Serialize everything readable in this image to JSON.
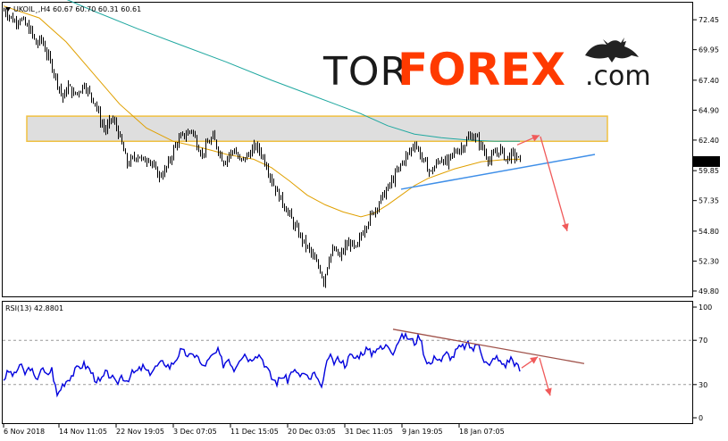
{
  "header": {
    "instrument_line": "UKOIL¸,H4  60.67 60.70 60.31 60.61",
    "rsi_line": "RSI(13) 42.8801"
  },
  "logo": {
    "part1": "TOR",
    "part2": "FOREX",
    "part3": ".com",
    "icon": "bull-bear-icon"
  },
  "colors": {
    "candle": "#000000",
    "ma_fast": "#e0a000",
    "ma_slow": "#20a8a0",
    "zone_fill": "#dedede",
    "zone_border": "#f0c040",
    "trend_blue": "#3f8fe8",
    "arrow_red": "#f05a5a",
    "rsi_line": "#0000dd",
    "rsi_trend": "#a0524a",
    "current_price_bg": "#000000"
  },
  "chart_data": [
    {
      "type": "candlestick",
      "symbol": "UKOIL",
      "timeframe": "H4",
      "ohlc_current": {
        "open": 60.67,
        "high": 60.7,
        "low": 60.31,
        "close": 60.61
      },
      "y_ticks": [
        72.45,
        69.95,
        67.4,
        64.9,
        62.4,
        59.85,
        57.35,
        54.8,
        52.3,
        49.8
      ],
      "ylim": [
        49.5,
        73.8
      ],
      "current_price": "60.61",
      "x_tick_labels": [
        "6 Nov 2018",
        "14 Nov 11:05",
        "22 Nov 19:05",
        "3 Dec 07:05",
        "11 Dec 15:05",
        "20 Dec 03:05",
        "31 Dec 11:05",
        "9 Jan 19:05",
        "18 Jan 07:05"
      ],
      "close_path": [
        [
          0,
          73.2
        ],
        [
          6,
          72.8
        ],
        [
          12,
          72.3
        ],
        [
          18,
          72.6
        ],
        [
          24,
          72.0
        ],
        [
          30,
          71.5
        ],
        [
          36,
          70.4
        ],
        [
          42,
          70.8
        ],
        [
          48,
          69.6
        ],
        [
          54,
          68.5
        ],
        [
          60,
          67.2
        ],
        [
          66,
          65.9
        ],
        [
          72,
          66.9
        ],
        [
          78,
          66.2
        ],
        [
          84,
          66.5
        ],
        [
          90,
          67.1
        ],
        [
          96,
          66.2
        ],
        [
          102,
          65.6
        ],
        [
          108,
          64.0
        ],
        [
          114,
          63.2
        ],
        [
          120,
          64.2
        ],
        [
          126,
          63.5
        ],
        [
          132,
          62.0
        ],
        [
          138,
          60.4
        ],
        [
          144,
          60.8
        ],
        [
          150,
          61.2
        ],
        [
          156,
          60.6
        ],
        [
          162,
          61.0
        ],
        [
          168,
          60.0
        ],
        [
          174,
          59.4
        ],
        [
          180,
          59.8
        ],
        [
          186,
          60.8
        ],
        [
          192,
          62.0
        ],
        [
          198,
          62.6
        ],
        [
          204,
          62.9
        ],
        [
          210,
          63.3
        ],
        [
          216,
          62.1
        ],
        [
          222,
          61.2
        ],
        [
          228,
          62.1
        ],
        [
          234,
          62.6
        ],
        [
          240,
          61.6
        ],
        [
          246,
          60.6
        ],
        [
          252,
          61.2
        ],
        [
          258,
          61.6
        ],
        [
          264,
          60.6
        ],
        [
          270,
          60.9
        ],
        [
          276,
          61.4
        ],
        [
          282,
          61.9
        ],
        [
          288,
          61.3
        ],
        [
          294,
          60.3
        ],
        [
          300,
          59.0
        ],
        [
          306,
          58.0
        ],
        [
          312,
          57.2
        ],
        [
          318,
          56.4
        ],
        [
          324,
          55.4
        ],
        [
          330,
          54.6
        ],
        [
          336,
          53.8
        ],
        [
          342,
          53.2
        ],
        [
          348,
          52.3
        ],
        [
          354,
          51.6
        ],
        [
          358,
          50.6
        ],
        [
          364,
          52.7
        ],
        [
          370,
          53.2
        ],
        [
          376,
          52.6
        ],
        [
          382,
          53.5
        ],
        [
          388,
          53.8
        ],
        [
          394,
          53.2
        ],
        [
          400,
          54.5
        ],
        [
          406,
          55.5
        ],
        [
          412,
          56.2
        ],
        [
          418,
          57.0
        ],
        [
          424,
          57.7
        ],
        [
          430,
          58.4
        ],
        [
          436,
          59.2
        ],
        [
          442,
          60.0
        ],
        [
          448,
          60.8
        ],
        [
          454,
          61.4
        ],
        [
          460,
          62.2
        ],
        [
          466,
          61.2
        ],
        [
          472,
          60.3
        ],
        [
          478,
          59.7
        ],
        [
          484,
          60.4
        ],
        [
          490,
          60.9
        ],
        [
          496,
          60.4
        ],
        [
          502,
          61.2
        ],
        [
          508,
          61.6
        ],
        [
          514,
          61.9
        ],
        [
          520,
          62.6
        ],
        [
          526,
          62.8
        ],
        [
          532,
          62.2
        ],
        [
          538,
          61.4
        ],
        [
          544,
          60.7
        ],
        [
          550,
          61.3
        ],
        [
          556,
          61.6
        ],
        [
          562,
          60.8
        ],
        [
          568,
          61.2
        ],
        [
          574,
          61.0
        ],
        [
          578,
          60.6
        ]
      ],
      "ma_fast": [
        [
          0,
          73.6
        ],
        [
          40,
          72.6
        ],
        [
          70,
          70.6
        ],
        [
          100,
          68.0
        ],
        [
          130,
          65.4
        ],
        [
          160,
          63.4
        ],
        [
          190,
          62.3
        ],
        [
          220,
          61.8
        ],
        [
          250,
          61.2
        ],
        [
          280,
          60.8
        ],
        [
          300,
          60.1
        ],
        [
          320,
          59.0
        ],
        [
          340,
          57.8
        ],
        [
          360,
          57.0
        ],
        [
          380,
          56.4
        ],
        [
          400,
          56.0
        ],
        [
          415,
          56.3
        ],
        [
          430,
          57.0
        ],
        [
          445,
          57.8
        ],
        [
          460,
          58.6
        ],
        [
          475,
          59.2
        ],
        [
          490,
          59.6
        ],
        [
          505,
          60.0
        ],
        [
          520,
          60.3
        ],
        [
          535,
          60.6
        ],
        [
          550,
          60.7
        ],
        [
          565,
          60.8
        ],
        [
          578,
          60.8
        ]
      ],
      "ma_slow": [
        [
          0,
          76.5
        ],
        [
          50,
          74.8
        ],
        [
          100,
          73.2
        ],
        [
          150,
          71.7
        ],
        [
          200,
          70.3
        ],
        [
          250,
          68.9
        ],
        [
          300,
          67.4
        ],
        [
          350,
          66.0
        ],
        [
          400,
          64.6
        ],
        [
          430,
          63.6
        ],
        [
          460,
          62.9
        ],
        [
          490,
          62.6
        ],
        [
          520,
          62.4
        ],
        [
          550,
          62.3
        ],
        [
          578,
          62.3
        ]
      ],
      "zone": {
        "top": 64.4,
        "bottom": 62.3
      },
      "trendline": [
        [
          445,
          58.3
        ],
        [
          662,
          61.2
        ]
      ],
      "arrows": [
        {
          "from": [
            575,
            62.0
          ],
          "to": [
            600,
            62.8
          ]
        },
        {
          "from": [
            601,
            62.7
          ],
          "to": [
            631,
            54.8
          ]
        }
      ]
    },
    {
      "type": "line",
      "name": "RSI(13)",
      "value": 42.8801,
      "y_ticks": [
        100,
        70,
        30,
        0
      ],
      "levels": [
        70,
        30
      ],
      "ylim": [
        0,
        100
      ],
      "values_path": [
        [
          0,
          35
        ],
        [
          6,
          42
        ],
        [
          12,
          38
        ],
        [
          18,
          48
        ],
        [
          24,
          40
        ],
        [
          30,
          46
        ],
        [
          36,
          33
        ],
        [
          42,
          45
        ],
        [
          48,
          38
        ],
        [
          54,
          44
        ],
        [
          60,
          20
        ],
        [
          66,
          30
        ],
        [
          72,
          35
        ],
        [
          78,
          40
        ],
        [
          84,
          46
        ],
        [
          90,
          48
        ],
        [
          96,
          44
        ],
        [
          102,
          36
        ],
        [
          108,
          32
        ],
        [
          114,
          40
        ],
        [
          120,
          38
        ],
        [
          126,
          30
        ],
        [
          132,
          38
        ],
        [
          138,
          34
        ],
        [
          144,
          40
        ],
        [
          150,
          42
        ],
        [
          156,
          46
        ],
        [
          162,
          40
        ],
        [
          168,
          44
        ],
        [
          174,
          48
        ],
        [
          180,
          50
        ],
        [
          186,
          46
        ],
        [
          192,
          52
        ],
        [
          198,
          60
        ],
        [
          204,
          58
        ],
        [
          210,
          55
        ],
        [
          216,
          58
        ],
        [
          222,
          46
        ],
        [
          228,
          50
        ],
        [
          234,
          56
        ],
        [
          240,
          60
        ],
        [
          246,
          48
        ],
        [
          252,
          54
        ],
        [
          258,
          44
        ],
        [
          264,
          54
        ],
        [
          270,
          58
        ],
        [
          276,
          52
        ],
        [
          282,
          58
        ],
        [
          288,
          56
        ],
        [
          294,
          46
        ],
        [
          300,
          36
        ],
        [
          306,
          32
        ],
        [
          312,
          38
        ],
        [
          318,
          34
        ],
        [
          324,
          44
        ],
        [
          330,
          38
        ],
        [
          336,
          40
        ],
        [
          342,
          34
        ],
        [
          348,
          40
        ],
        [
          354,
          28
        ],
        [
          358,
          34
        ],
        [
          364,
          56
        ],
        [
          370,
          50
        ],
        [
          376,
          54
        ],
        [
          382,
          48
        ],
        [
          388,
          56
        ],
        [
          394,
          54
        ],
        [
          400,
          58
        ],
        [
          406,
          62
        ],
        [
          412,
          58
        ],
        [
          418,
          64
        ],
        [
          424,
          62
        ],
        [
          430,
          66
        ],
        [
          436,
          60
        ],
        [
          442,
          70
        ],
        [
          448,
          74
        ],
        [
          454,
          72
        ],
        [
          460,
          68
        ],
        [
          466,
          74
        ],
        [
          472,
          54
        ],
        [
          478,
          48
        ],
        [
          484,
          56
        ],
        [
          490,
          52
        ],
        [
          496,
          58
        ],
        [
          502,
          54
        ],
        [
          508,
          62
        ],
        [
          514,
          64
        ],
        [
          520,
          66
        ],
        [
          526,
          62
        ],
        [
          532,
          68
        ],
        [
          538,
          52
        ],
        [
          544,
          46
        ],
        [
          550,
          56
        ],
        [
          556,
          50
        ],
        [
          562,
          48
        ],
        [
          568,
          54
        ],
        [
          574,
          48
        ],
        [
          578,
          43
        ]
      ],
      "trendline": [
        [
          436,
          80
        ],
        [
          650,
          49
        ]
      ],
      "arrows": [
        {
          "from": [
            580,
            45
          ],
          "to": [
            598,
            55
          ]
        },
        {
          "from": [
            600,
            54
          ],
          "to": [
            612,
            20
          ]
        }
      ]
    }
  ]
}
